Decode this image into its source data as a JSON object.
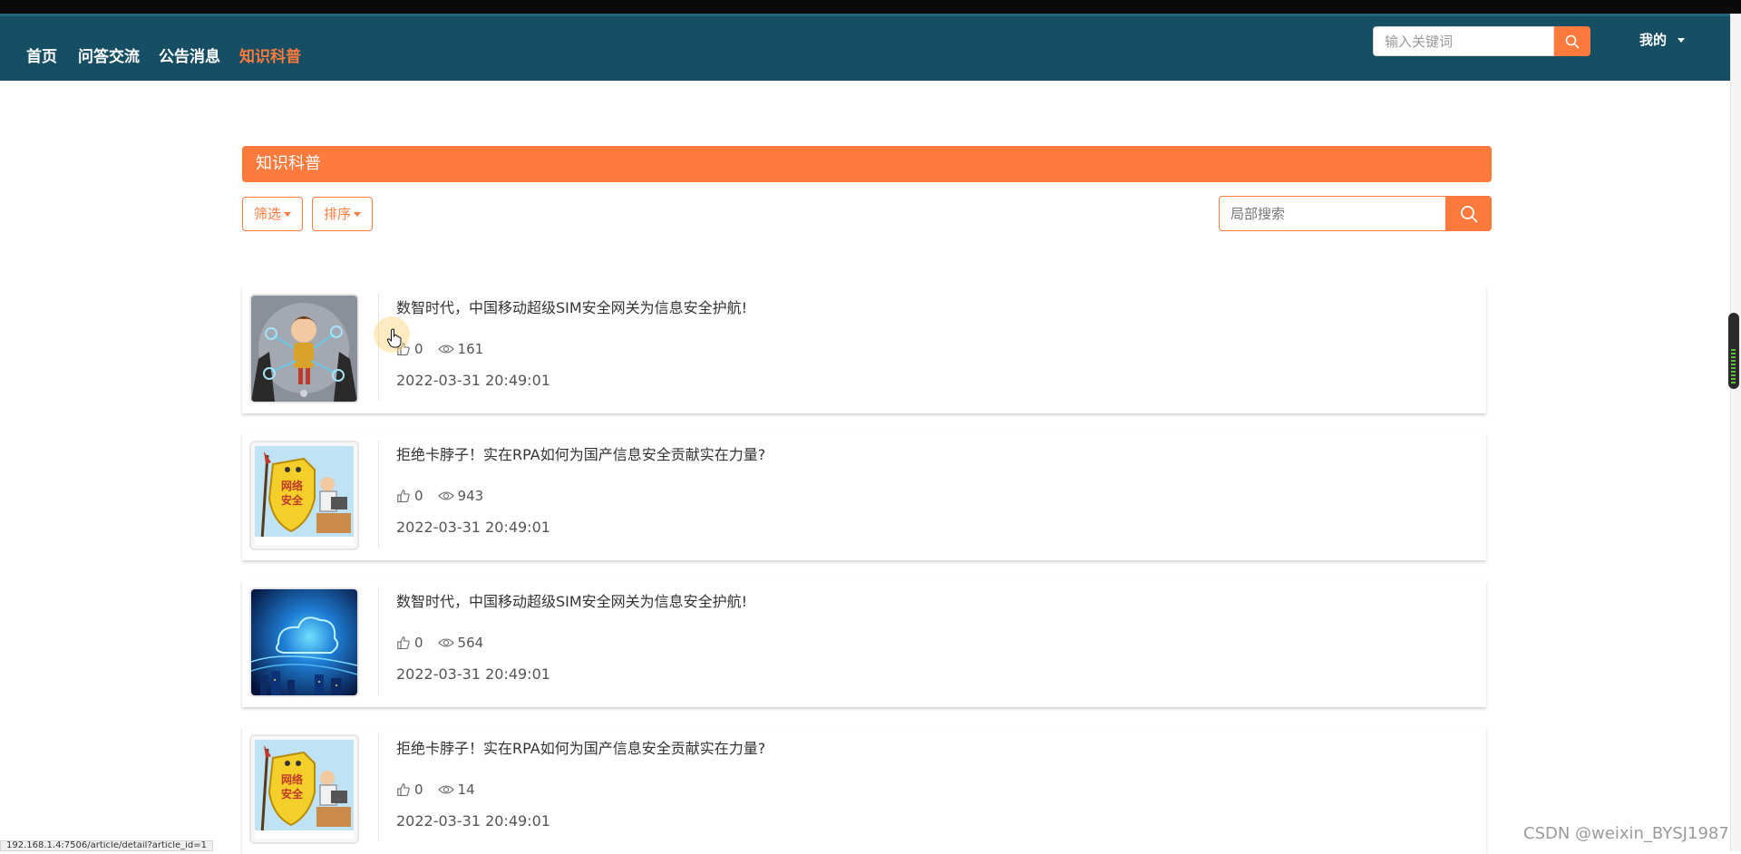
{
  "nav": {
    "items": [
      {
        "label": "首页",
        "active": false
      },
      {
        "label": "问答交流",
        "active": false
      },
      {
        "label": "公告消息",
        "active": false
      },
      {
        "label": "知识科普",
        "active": true
      }
    ],
    "search_placeholder": "输入关键词",
    "user_label": "我的"
  },
  "section": {
    "title": "知识科普",
    "filter_label": "筛选",
    "sort_label": "排序",
    "search_placeholder": "局部搜索"
  },
  "articles": [
    {
      "title": "数智时代，中国移动超级SIM安全网关为信息安全护航!",
      "likes": "0",
      "views": "161",
      "date": "2022-03-31 20:49:01",
      "image": "cartoon-network-man"
    },
    {
      "title": "拒绝卡脖子！实在RPA如何为国产信息安全贡献实在力量?",
      "likes": "0",
      "views": "943",
      "date": "2022-03-31 20:49:01",
      "image": "network-security-shield"
    },
    {
      "title": "数智时代，中国移动超级SIM安全网关为信息安全护航!",
      "likes": "0",
      "views": "564",
      "date": "2022-03-31 20:49:01",
      "image": "blue-cloud-city"
    },
    {
      "title": "拒绝卡脖子！实在RPA如何为国产信息安全贡献实在力量?",
      "likes": "0",
      "views": "14",
      "date": "2022-03-31 20:49:01",
      "image": "network-security-shield"
    }
  ],
  "status_bar": {
    "url": "192.168.1.4:7506/article/detail?article_id=1"
  },
  "watermark": "CSDN @weixin_BYSJ1987",
  "colors": {
    "navbar": "#164e64",
    "accent": "#ff7a3d",
    "text": "#333333"
  },
  "icons": {
    "like": "thumbs-up-icon",
    "view": "eye-icon",
    "search": "search-icon"
  }
}
